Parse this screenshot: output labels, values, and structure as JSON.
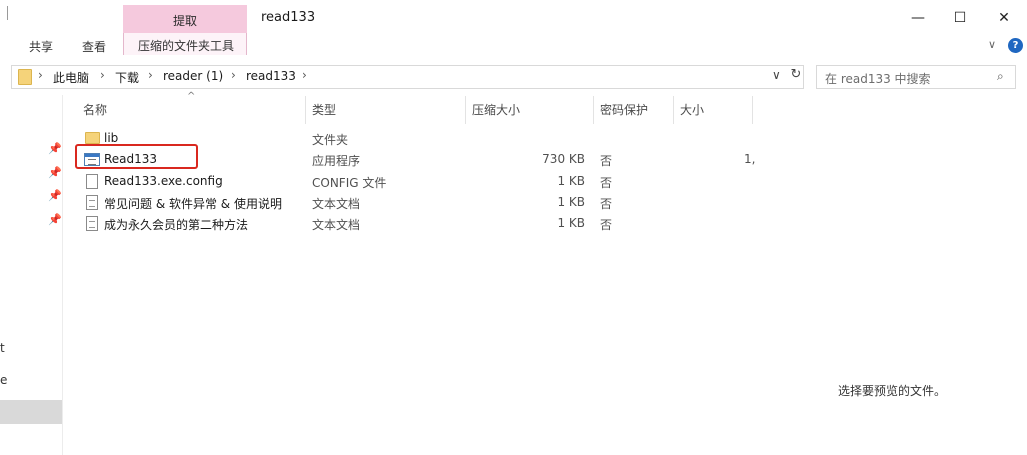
{
  "window": {
    "title": "read133",
    "context_tab": "提取",
    "tools_tab": "压缩的文件夹工具",
    "ribbon_tabs": [
      "共享",
      "查看"
    ],
    "controls": {
      "minimize": "—",
      "maximize": "☐",
      "close": "✕",
      "help": "?",
      "expand": "∨"
    }
  },
  "address": {
    "crumbs": [
      "此电脑",
      "下载",
      "reader (1)",
      "read133"
    ],
    "separator": "›",
    "dropdown": "∨",
    "refresh": "↻"
  },
  "search": {
    "placeholder": "在 read133 中搜索",
    "icon": "⌕"
  },
  "nav": {
    "pin": "📌",
    "fragments": [
      "t",
      "e"
    ]
  },
  "columns": {
    "name": "名称",
    "type": "类型",
    "compressed_size": "压缩大小",
    "password_protected": "密码保护",
    "size": "大小",
    "sort_indicator": "^"
  },
  "files": [
    {
      "name": "lib",
      "icon": "folder-icon",
      "type": "文件夹",
      "compressed_size": "",
      "protected": "",
      "size": ""
    },
    {
      "name": "Read133",
      "icon": "application-icon",
      "type": "应用程序",
      "compressed_size": "730 KB",
      "protected": "否",
      "size": "1,"
    },
    {
      "name": "Read133.exe.config",
      "icon": "config-file-icon",
      "type": "CONFIG 文件",
      "compressed_size": "1 KB",
      "protected": "否",
      "size": ""
    },
    {
      "name": "常见问题 & 软件异常 & 使用说明",
      "icon": "text-document-icon",
      "type": "文本文档",
      "compressed_size": "1 KB",
      "protected": "否",
      "size": ""
    },
    {
      "name": "成为永久会员的第二种方法",
      "icon": "text-document-icon",
      "type": "文本文档",
      "compressed_size": "1 KB",
      "protected": "否",
      "size": ""
    }
  ],
  "preview": {
    "message": "选择要预览的文件。"
  },
  "colors": {
    "context_tab": "#f5c9dd",
    "highlight": "#d9281f",
    "folder": "#f5d37a"
  }
}
